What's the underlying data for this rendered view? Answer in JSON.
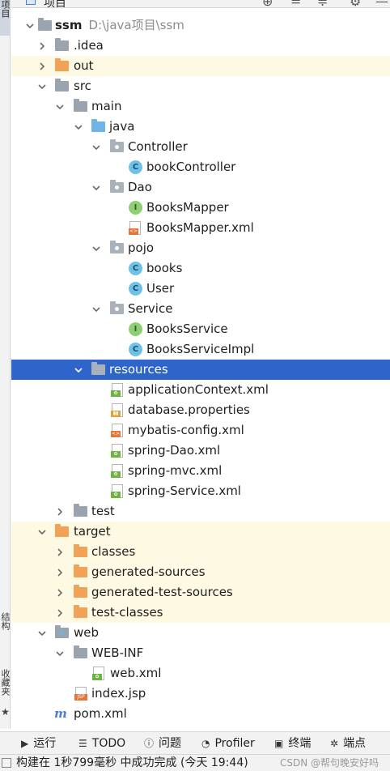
{
  "window": {
    "panel_title": "项目",
    "side_tabs": {
      "project": "项目",
      "structure": "结构",
      "favorites": "收藏夹"
    }
  },
  "tree": [
    {
      "label": "ssm",
      "path": "D:\\java项目\\ssm",
      "icon": "module-folder",
      "expanded": true
    },
    {
      "label": ".idea",
      "icon": "folder-grey",
      "expanded": false
    },
    {
      "label": "out",
      "icon": "folder-orange",
      "expanded": false
    },
    {
      "label": "src",
      "icon": "folder-grey",
      "expanded": true
    },
    {
      "label": "main",
      "icon": "folder-grey",
      "expanded": true
    },
    {
      "label": "java",
      "icon": "folder-blue-source",
      "expanded": true
    },
    {
      "label": "Controller",
      "icon": "package",
      "expanded": true
    },
    {
      "label": "bookController",
      "icon": "class-c"
    },
    {
      "label": "Dao",
      "icon": "package",
      "expanded": true
    },
    {
      "label": "BooksMapper",
      "icon": "interface-i"
    },
    {
      "label": "BooksMapper.xml",
      "icon": "xml-file"
    },
    {
      "label": "pojo",
      "icon": "package",
      "expanded": true
    },
    {
      "label": "books",
      "icon": "class-c"
    },
    {
      "label": "User",
      "icon": "class-c"
    },
    {
      "label": "Service",
      "icon": "package",
      "expanded": true
    },
    {
      "label": "BooksService",
      "icon": "interface-i"
    },
    {
      "label": "BooksServiceImpl",
      "icon": "class-c"
    },
    {
      "label": "resources",
      "icon": "folder-resources",
      "expanded": true,
      "selected": true
    },
    {
      "label": "applicationContext.xml",
      "icon": "spring-xml-file"
    },
    {
      "label": "database.properties",
      "icon": "properties-file"
    },
    {
      "label": "mybatis-config.xml",
      "icon": "xml-file"
    },
    {
      "label": "spring-Dao.xml",
      "icon": "spring-xml-file"
    },
    {
      "label": "spring-mvc.xml",
      "icon": "spring-xml-file"
    },
    {
      "label": "spring-Service.xml",
      "icon": "spring-xml-file"
    },
    {
      "label": "test",
      "icon": "folder-grey",
      "expanded": false
    },
    {
      "label": "target",
      "icon": "folder-orange",
      "expanded": true
    },
    {
      "label": "classes",
      "icon": "folder-orange",
      "expanded": false
    },
    {
      "label": "generated-sources",
      "icon": "folder-orange",
      "expanded": false
    },
    {
      "label": "generated-test-sources",
      "icon": "folder-orange",
      "expanded": false
    },
    {
      "label": "test-classes",
      "icon": "folder-orange",
      "expanded": false
    },
    {
      "label": "web",
      "icon": "folder-web",
      "expanded": true
    },
    {
      "label": "WEB-INF",
      "icon": "folder-grey",
      "expanded": true
    },
    {
      "label": "web.xml",
      "icon": "spring-xml-file"
    },
    {
      "label": "index.jsp",
      "icon": "jsp-file"
    },
    {
      "label": "pom.xml",
      "icon": "maven-file"
    }
  ],
  "bottom_tabs": {
    "run": "运行",
    "todo": "TODO",
    "problems": "问题",
    "profiler": "Profiler",
    "terminal": "终端",
    "breakpoints": "端点"
  },
  "status": {
    "message": "构建在 1秒799毫秒 中成功完成 (今天 19:44)",
    "watermark": "CSDN @帮句晚安好吗"
  },
  "colors": {
    "selection": "#2f65ca",
    "excluded_highlight": "#fdf9e3",
    "folder_orange": "#f0a257",
    "source_blue": "#6fb4e6",
    "class_icon": "#6fc1e8",
    "interface_icon": "#8fcf73"
  }
}
